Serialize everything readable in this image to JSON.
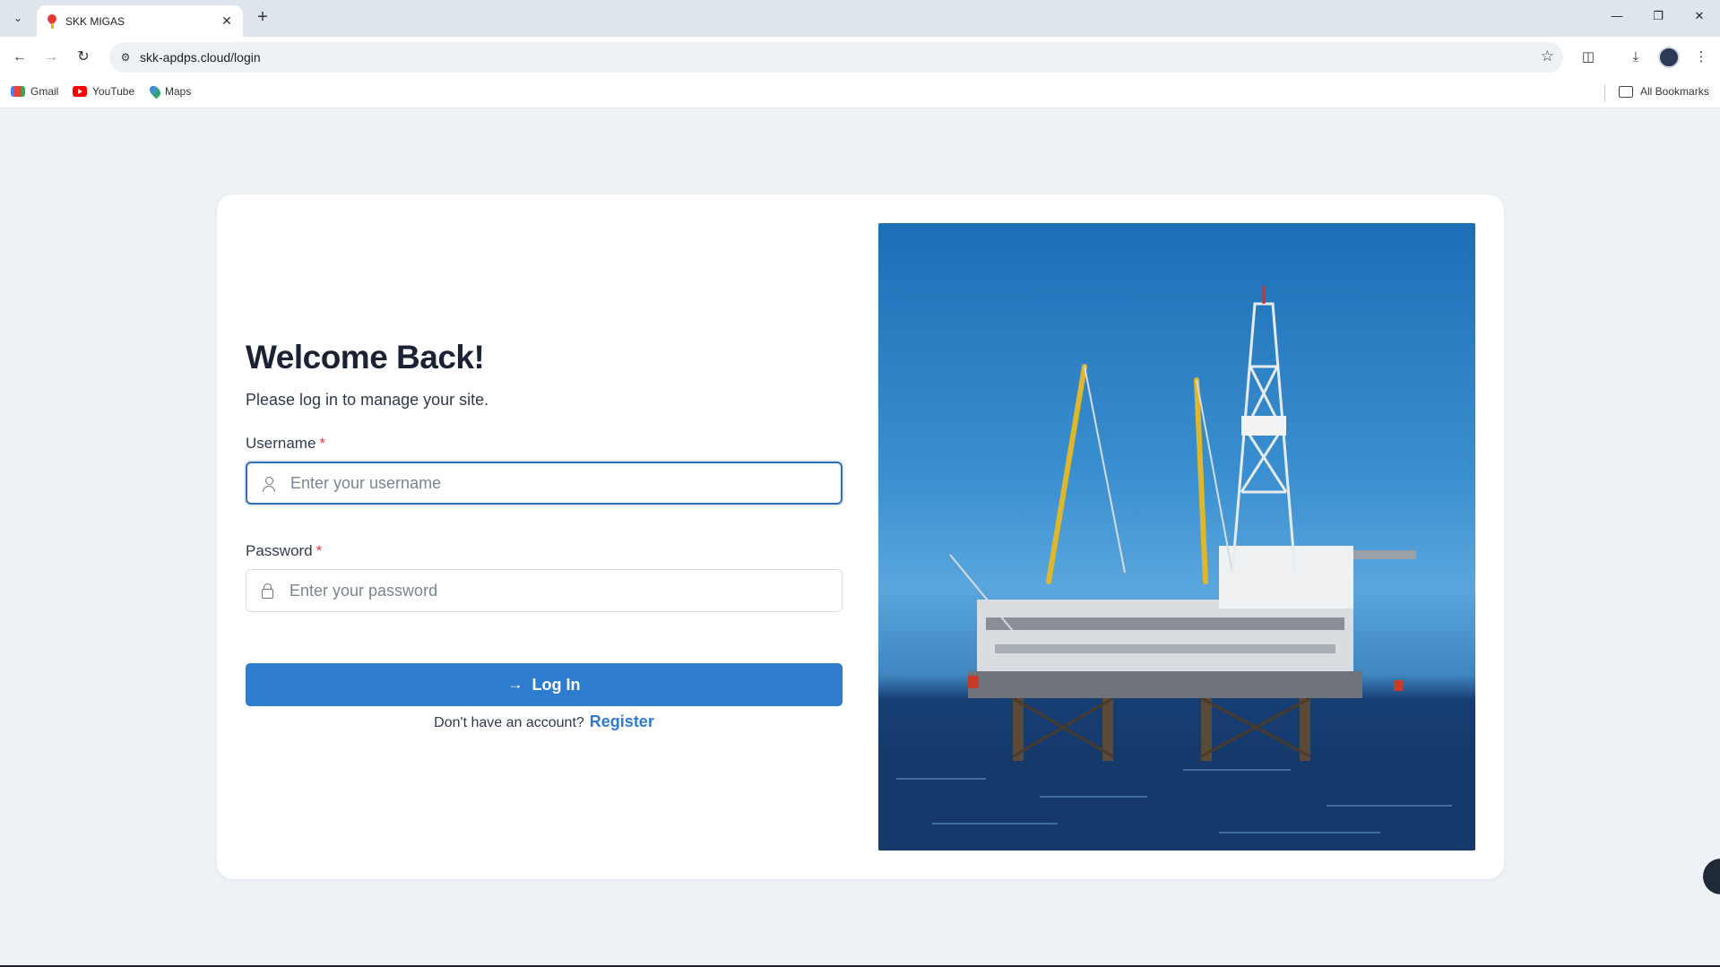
{
  "browser": {
    "tab_title": "SKK MIGAS",
    "url": "skk-apdps.cloud/login",
    "bookmarks": [
      {
        "label": "Gmail",
        "icon": "gmail-icon"
      },
      {
        "label": "YouTube",
        "icon": "youtube-icon"
      },
      {
        "label": "Maps",
        "icon": "maps-icon"
      }
    ],
    "all_bookmarks_label": "All Bookmarks"
  },
  "login": {
    "heading": "Welcome Back!",
    "subtitle": "Please log in to manage your site.",
    "username": {
      "label": "Username",
      "required_mark": "*",
      "placeholder": "Enter your username",
      "value": ""
    },
    "password": {
      "label": "Password",
      "required_mark": "*",
      "placeholder": "Enter your password",
      "value": ""
    },
    "login_button": "Log In",
    "no_account_text": "Don't have an account?",
    "register_link": "Register"
  },
  "hero_image": {
    "subject": "offshore-oil-platform"
  },
  "colors": {
    "primary": "#2e7ccd",
    "background": "#eef2f6",
    "required": "#e53935"
  }
}
